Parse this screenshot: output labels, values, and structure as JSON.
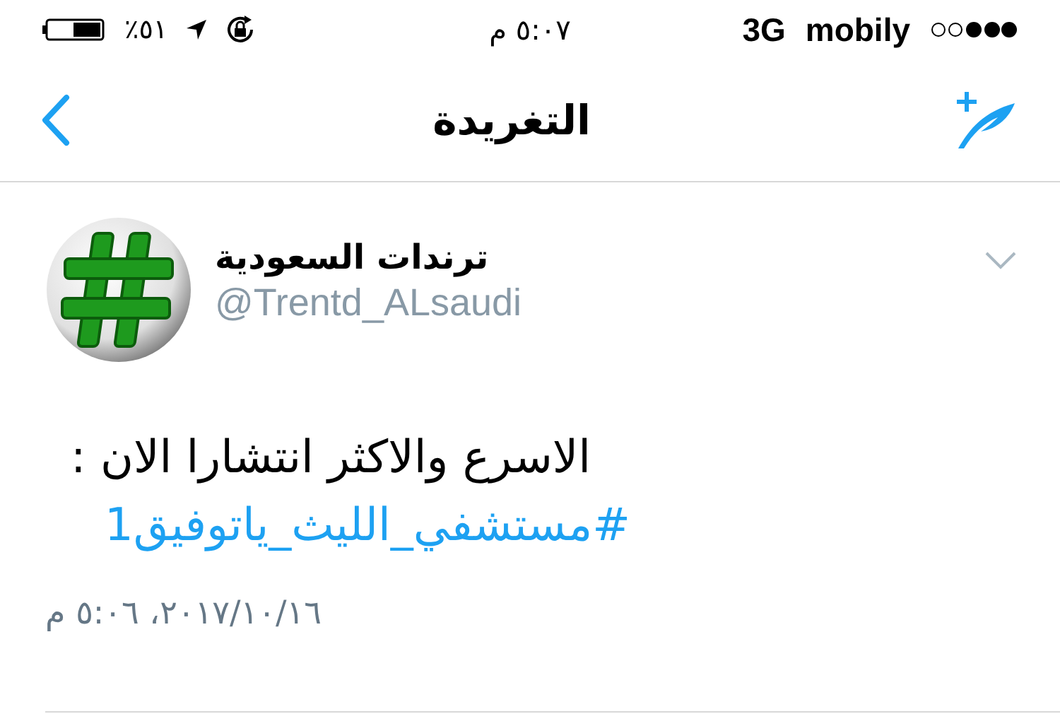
{
  "status_bar": {
    "battery": "٥١٪",
    "time": "٥:٠٧ م",
    "network": "3G",
    "carrier": "mobily"
  },
  "nav": {
    "title": "التغريدة"
  },
  "tweet": {
    "name": "ترندات السعودية",
    "handle": "@Trentd_ALsaudi",
    "text": "الاسرع والاكثر انتشارا الان :",
    "hashtag": "#مستشفي_الليث_ياتوفيق1",
    "timestamp": "٢٠١٧/١٠/١٦، ٥:٠٦ م"
  }
}
